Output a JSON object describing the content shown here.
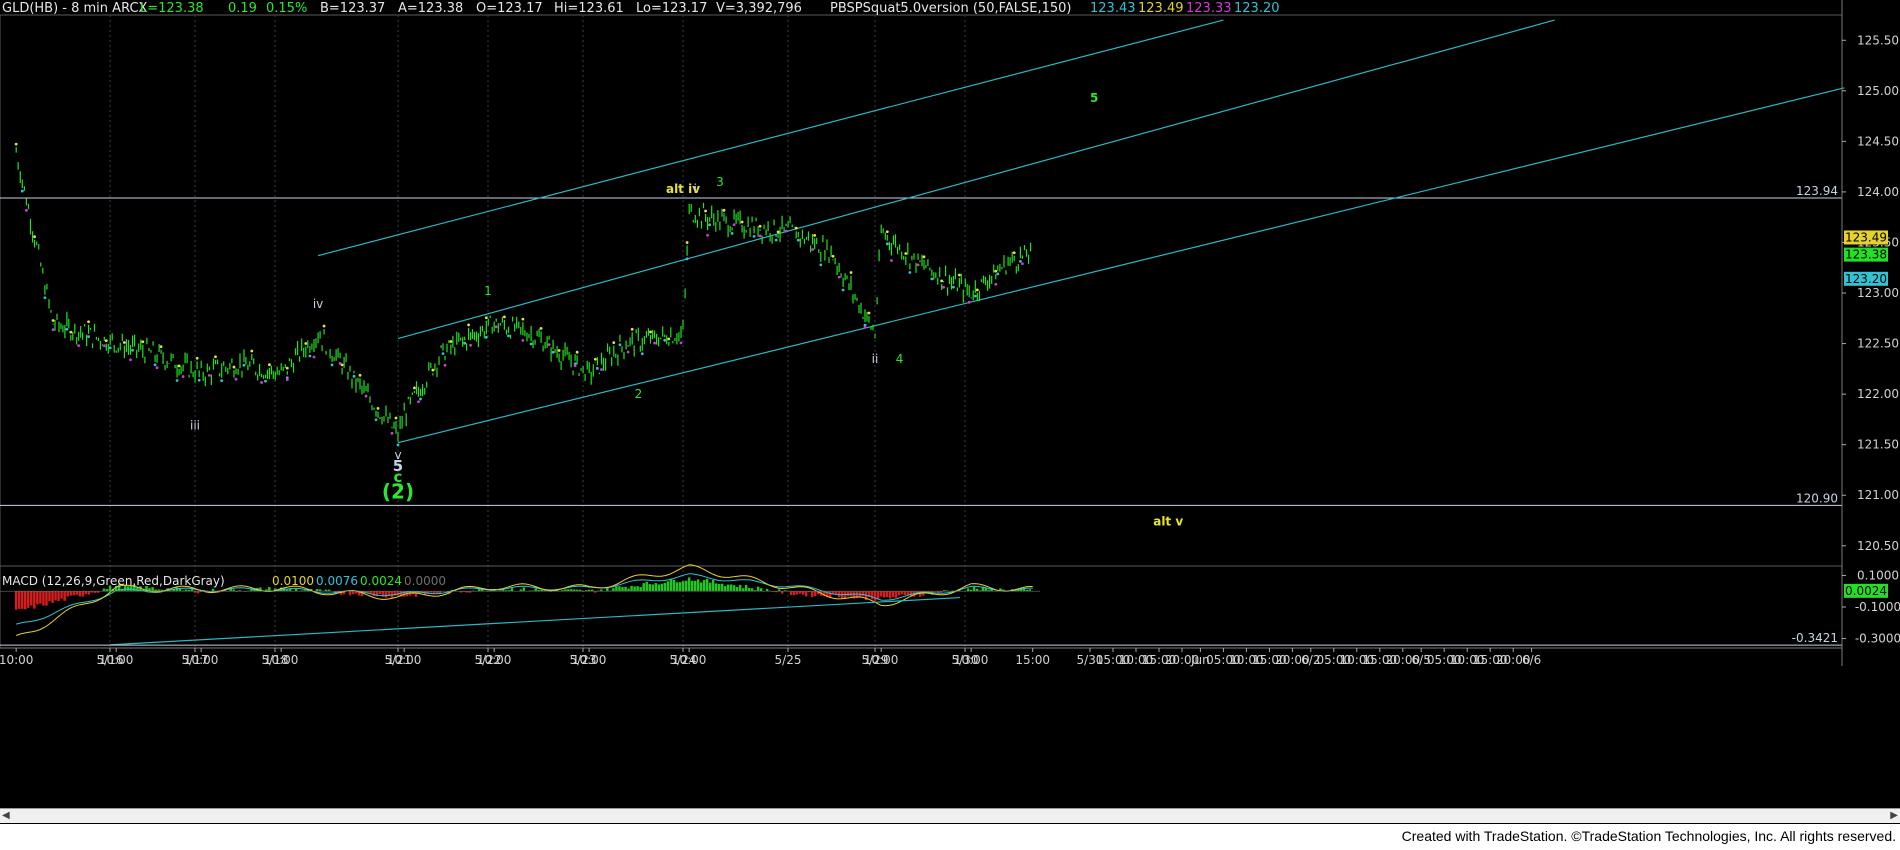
{
  "header": {
    "symbol": "GLD(HB) - 8 min  ARCX",
    "last": "L=123.38",
    "change": "0.19",
    "pct_change": "0.15%",
    "bid": "B=123.37",
    "ask": "A=123.38",
    "open": "O=123.17",
    "high": "Hi=123.61",
    "low": "Lo=123.17",
    "volume": "V=3,392,796",
    "study": "PBSPSquat5.0version (50,FALSE,150)",
    "study_values": [
      {
        "text": "123.43",
        "color": "#2ec4d6"
      },
      {
        "text": "123.49",
        "color": "#e6d22e"
      },
      {
        "text": "123.33",
        "color": "#d63ad6"
      },
      {
        "text": "123.20",
        "color": "#2ec4d6"
      }
    ]
  },
  "macd_header": {
    "label": "MACD (12,26,9,Green,Red,DarkGray)",
    "values": [
      {
        "text": "0.0100",
        "color": "#e6d22e"
      },
      {
        "text": "0.0076",
        "color": "#2ec4d6"
      },
      {
        "text": "0.0024",
        "color": "#2ee62e"
      },
      {
        "text": "0.0000",
        "color": "#6e6e6e"
      }
    ]
  },
  "footer": {
    "credit": "Created with TradeStation. ©TradeStation Technologies, Inc. All rights reserved."
  },
  "colors": {
    "background": "#000000",
    "price": "#22e022",
    "channel": "#2ab7c4",
    "hline": "#c8d2e6",
    "wave_green": "#2ee62e",
    "wave_yellow": "#e6e62e",
    "wave_white": "#c8d2e6",
    "macd_up": "#1ec81e",
    "macd_down": "#d21e1e",
    "macd_line": "#e6d22e",
    "signal_line": "#2ec4d6"
  },
  "chart_data": [
    {
      "type": "line",
      "name": "price",
      "series": [
        {
          "x": [
            "5/15 10:00",
            "5/15 13:00",
            "5/16 10:00",
            "5/16 13:00",
            "5/17 10:00",
            "5/17 13:00",
            "5/18 10:00",
            "5/18 13:00",
            "5/21 9:30",
            "5/21 10:00",
            "5/21 13:00",
            "5/22 10:00",
            "5/22 13:00",
            "5/23 10:00",
            "5/23 13:00",
            "5/24 9:30",
            "5/24 10:00",
            "5/24 13:00",
            "5/25 10:00",
            "5/25 13:00",
            "5/29 9:30",
            "5/29 10:00",
            "5/29 13:00",
            "5/30 10:00",
            "5/30 13:00",
            "5/30 15:00"
          ],
          "values": [
            124.4,
            122.7,
            122.5,
            122.4,
            122.2,
            122.3,
            122.2,
            122.6,
            121.6,
            121.8,
            122.4,
            122.7,
            122.6,
            122.2,
            122.5,
            122.6,
            123.8,
            123.7,
            123.6,
            123.4,
            122.6,
            123.6,
            123.3,
            123.0,
            123.3,
            123.4
          ]
        }
      ],
      "ylim": [
        120.3,
        125.75
      ],
      "y_ticks": [
        "125.50",
        "125.00",
        "124.50",
        "124.00",
        "123.50",
        "123.00",
        "122.50",
        "122.00",
        "121.50",
        "121.00",
        "120.50"
      ],
      "x_ticks": [
        "10:00",
        "5/16",
        "10:00",
        "5/17",
        "10:00",
        "5/18",
        "10:00",
        "5/21",
        "10:00",
        "5/22",
        "10:00",
        "5/23",
        "10:00",
        "5/24",
        "10:00",
        "5/25",
        "5/29",
        "10:00",
        "5/30",
        "10:00",
        "15:00",
        "5/31",
        "05:00",
        "10:00",
        "15:00",
        "20:00",
        "Jun",
        "05:00",
        "10:00",
        "15:00",
        "20:00",
        "6/2",
        "05:00",
        "10:00",
        "15:00",
        "20:00",
        "6/5",
        "05:00",
        "10:00",
        "15:00",
        "20:00",
        "6/6"
      ],
      "hlines": [
        {
          "value": 123.94,
          "label": "123.94"
        },
        {
          "value": 120.9,
          "label": "120.90"
        }
      ],
      "price_tags": [
        {
          "value": 123.49,
          "label": "123.49",
          "color": "#e6d22e"
        },
        {
          "value": 123.38,
          "label": "123.38",
          "color": "#22e022"
        },
        {
          "value": 123.2,
          "label": "123.20",
          "color": "#2ec4d6"
        }
      ],
      "wave_labels": [
        {
          "text": "iii",
          "x": "5/17 9:30",
          "y": 121.65,
          "color": "#c8d2e6"
        },
        {
          "text": "iv",
          "x": "5/18 13:00",
          "y": 122.85,
          "color": "#c8d2e6"
        },
        {
          "text": "v",
          "x": "5/21 9:30",
          "y": 121.36,
          "color": "#c8d2e6"
        },
        {
          "text": "5",
          "x": "5/21 9:30",
          "y": 121.24,
          "color": "#c8d2e6"
        },
        {
          "text": "c",
          "x": "5/21 9:30",
          "y": 121.13,
          "color": "#2ee62e"
        },
        {
          "text": "(2)",
          "x": "5/21 9:30",
          "y": 120.97,
          "color": "#2ee62e"
        },
        {
          "text": "1",
          "x": "5/22 9:30",
          "y": 122.98,
          "color": "#2ee62e"
        },
        {
          "text": "2",
          "x": "5/23 14:00",
          "y": 121.96,
          "color": "#2ee62e"
        },
        {
          "text": "alt iv",
          "x": "5/24 9:30",
          "y": 123.99,
          "color": "#e6e62e"
        },
        {
          "text": "i",
          "x": "5/24 10:30",
          "y": 123.99,
          "color": "#c8d2e6"
        },
        {
          "text": "3",
          "x": "5/24 12:30",
          "y": 124.06,
          "color": "#2ee62e"
        },
        {
          "text": "ii",
          "x": "5/29 9:30",
          "y": 122.31,
          "color": "#c8d2e6"
        },
        {
          "text": "4",
          "x": "5/29 11:30",
          "y": 122.31,
          "color": "#2ee62e"
        },
        {
          "text": "5",
          "x": "5/30 20:00",
          "y": 124.89,
          "color": "#2ee62e"
        },
        {
          "text": "alt v",
          "x": "5/31 17:00",
          "y": 120.7,
          "color": "#e6e62e"
        }
      ],
      "channels": [
        {
          "from": [
            "5/18 13:00",
            123.37
          ],
          "to": [
            "6/1 05:00",
            125.7
          ]
        },
        {
          "from": [
            "5/21 9:30",
            122.55
          ],
          "to": [
            "6/4 05:00",
            125.7
          ]
        },
        {
          "from": [
            "5/21 9:30",
            121.52
          ],
          "to": [
            "6/6 20:00",
            125.03
          ]
        }
      ]
    },
    {
      "type": "line",
      "name": "macd",
      "series": [
        {
          "name": "MACD",
          "x": [
            "5/15 10:00",
            "5/16 10:00",
            "5/17 10:00",
            "5/18 10:00",
            "5/21 9:30",
            "5/22 10:00",
            "5/23 10:00",
            "5/24 10:00",
            "5/25 10:00",
            "5/29 10:00",
            "5/30 10:00",
            "5/30 15:00"
          ],
          "values": [
            -0.3,
            0.02,
            0.01,
            0.02,
            -0.04,
            0.03,
            0.02,
            0.15,
            0.02,
            -0.08,
            0.03,
            0.01
          ]
        },
        {
          "name": "Signal",
          "x": [
            "5/15 10:00",
            "5/16 10:00",
            "5/17 10:00",
            "5/18 10:00",
            "5/21 9:30",
            "5/22 10:00",
            "5/23 10:00",
            "5/24 10:00",
            "5/25 10:00",
            "5/29 10:00",
            "5/30 10:00",
            "5/30 15:00"
          ],
          "values": [
            -0.22,
            0.0,
            0.01,
            0.01,
            -0.02,
            0.02,
            0.02,
            0.1,
            0.03,
            -0.05,
            0.02,
            0.008
          ]
        }
      ],
      "ylim": [
        -0.36,
        0.16
      ],
      "y_ticks": [
        "0.1000",
        "-0.1000",
        "-0.3000"
      ],
      "hlines": [
        {
          "value": -0.3421,
          "label": "-0.3421"
        }
      ],
      "price_tags": [
        {
          "value": 0.0024,
          "label": "0.0024",
          "color": "#22e022"
        }
      ]
    }
  ]
}
